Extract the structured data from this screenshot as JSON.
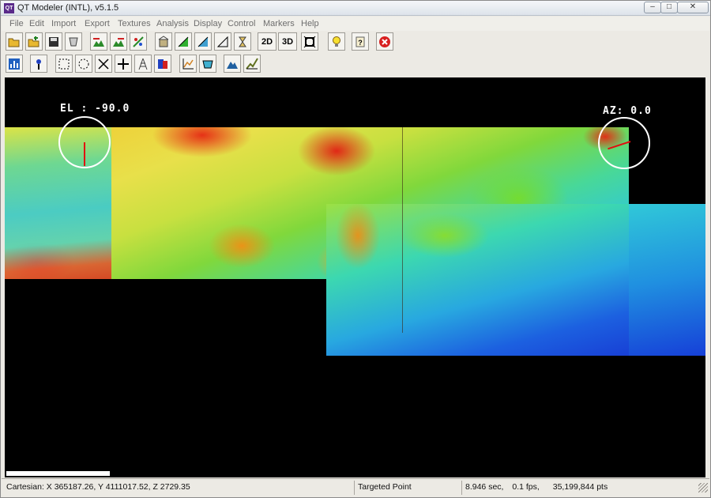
{
  "window": {
    "title": "QT Modeler (INTL), v5.1.5",
    "app_icon_text": "QT",
    "controls": {
      "minimize": "–",
      "maximize": "□",
      "close": "✕"
    }
  },
  "menu": [
    "File",
    "Edit",
    "Import",
    "Export",
    "Textures",
    "Analysis",
    "Display",
    "Control",
    "Markers",
    "Help"
  ],
  "toolbar1": {
    "buttons": [
      {
        "icon": "open-folder-icon"
      },
      {
        "icon": "open-append-icon"
      },
      {
        "icon": "save-icon"
      },
      {
        "icon": "export-model-icon"
      },
      {
        "icon": "load-terrain-icon"
      },
      {
        "icon": "merge-terrain-icon"
      },
      {
        "icon": "transform-icon"
      },
      {
        "icon": "building-icon"
      },
      {
        "icon": "color-ramp-icon"
      },
      {
        "icon": "gradient-icon"
      },
      {
        "icon": "slope-icon"
      },
      {
        "icon": "hourglass-icon"
      },
      {
        "icon": "view-2d",
        "text": "2D"
      },
      {
        "icon": "view-3d",
        "text": "3D"
      },
      {
        "icon": "fit-view-icon"
      },
      {
        "icon": "lightbulb-icon"
      },
      {
        "icon": "help-icon"
      },
      {
        "icon": "stop-icon"
      }
    ]
  },
  "toolbar2": {
    "buttons": [
      {
        "icon": "histogram-icon"
      },
      {
        "icon": "marker-pin-icon"
      },
      {
        "icon": "rect-select-icon"
      },
      {
        "icon": "circle-select-icon"
      },
      {
        "icon": "cut-icon"
      },
      {
        "icon": "crosshair-icon"
      },
      {
        "icon": "tower-icon"
      },
      {
        "icon": "color-swatch-icon"
      },
      {
        "icon": "profile-icon"
      },
      {
        "icon": "volume-icon"
      },
      {
        "icon": "mountain-icon"
      },
      {
        "icon": "line-of-sight-icon"
      }
    ]
  },
  "viewport": {
    "elevation_label": "EL : -90.0",
    "azimuth_label": "AZ: 0.0",
    "colors": {
      "background": "#000000",
      "compass_ring": "#ffffff",
      "needle": "#e01010"
    }
  },
  "status": {
    "coords": "Cartesian: X 365187.26, Y 4111017.52, Z 2729.35",
    "mode": "Targeted Point",
    "timing": "8.946 sec,",
    "fps": "0.1 fps,",
    "points": "35,199,844 pts"
  }
}
